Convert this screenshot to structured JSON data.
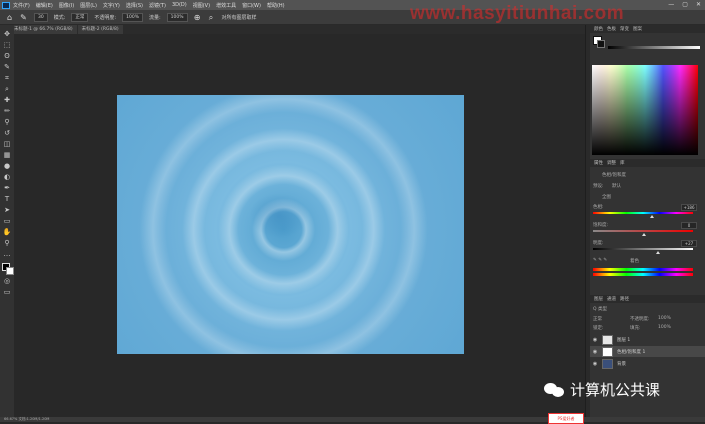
{
  "menubar": {
    "logo": "Ps",
    "items": [
      "文件(F)",
      "编辑(E)",
      "图像(I)",
      "图层(L)",
      "文字(Y)",
      "选择(S)",
      "滤镜(T)",
      "3D(D)",
      "视图(V)",
      "增效工具",
      "窗口(W)",
      "帮助(H)"
    ],
    "window_controls": [
      "—",
      "▢",
      "✕"
    ]
  },
  "options_bar": {
    "tool_icon": "brush-icon",
    "size_value": "30",
    "mode_label": "模式:",
    "opacity_label": "不透明度:",
    "flow_label": "流量:",
    "sample_label": "对所有图层取样"
  },
  "tabs": [
    "未标题-1 @ 66.7% (RGB/8)",
    "未标题-2 (RGB/8)"
  ],
  "toolbar": {
    "tools": [
      "move-icon",
      "marquee-icon",
      "lasso-icon",
      "quick-select-icon",
      "crop-icon",
      "eyedropper-icon",
      "healing-icon",
      "brush-icon",
      "stamp-icon",
      "history-brush-icon",
      "eraser-icon",
      "gradient-icon",
      "blur-icon",
      "dodge-icon",
      "pen-icon",
      "type-icon",
      "path-select-icon",
      "shape-icon",
      "hand-icon",
      "zoom-icon",
      "more-icon"
    ],
    "tool_glyphs": [
      "✥",
      "⬚",
      "ʘ",
      "✎",
      "⌗",
      "⌕",
      "✚",
      "✏",
      "⚲",
      "↺",
      "◫",
      "▦",
      "●",
      "◐",
      "✒",
      "T",
      "➤",
      "▭",
      "✋",
      "⚲",
      "…"
    ],
    "foreground": "#000000",
    "background": "#ffffff"
  },
  "canvas": {
    "image_colors": [
      "#4f9fcd",
      "#7bbbe0",
      "#5ea7d4"
    ]
  },
  "color_panel": {
    "tabs": [
      "颜色",
      "色板",
      "渐变",
      "图案"
    ]
  },
  "properties_panel": {
    "tabs": [
      "属性",
      "调整",
      "库"
    ],
    "header": "色相/饱和度",
    "preset_label": "预设:",
    "preset_value": "默认",
    "channel_value": "全图",
    "hue_label": "色相:",
    "hue_value": "+186",
    "saturation_label": "饱和度:",
    "saturation_value": "0",
    "lightness_label": "明度:",
    "lightness_value": "+27",
    "colorize_label": "着色"
  },
  "layers_panel": {
    "tabs": [
      "图层",
      "通道",
      "路径"
    ],
    "kind_label": "Q 类型",
    "blend_mode": "正常",
    "opacity_label": "不透明度:",
    "opacity_value": "100%",
    "lock_label": "锁定:",
    "fill_label": "填充:",
    "fill_value": "100%",
    "layers": [
      {
        "name": "图层 1",
        "visible": "👁"
      },
      {
        "name": "色相/饱和度 1",
        "visible": "👁"
      },
      {
        "name": "背景",
        "visible": "👁"
      }
    ]
  },
  "status_bar": {
    "text": "66.67%    文档:1.20M/1.20M"
  },
  "watermarks": {
    "top": "www.hasyitiunhai.com",
    "bottom": "计算机公共课",
    "badge": "PS爱好者"
  }
}
